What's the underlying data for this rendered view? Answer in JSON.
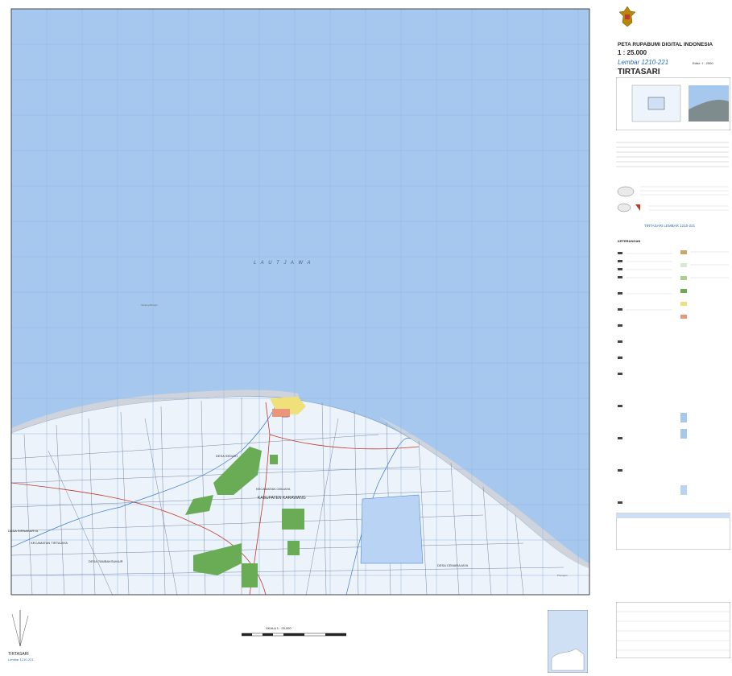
{
  "header": {
    "title": "PETA RUPABUMI DIGITAL INDONESIA",
    "scale": "1 : 25.000",
    "sheet": "Lembar 1210-221",
    "name": "TIRTASARI",
    "edition": "Edisi : I - 2000"
  },
  "map": {
    "sea_label": "L A U T   J A W A",
    "place_labels": [
      "DESA SEDARI",
      "KECAMATAN CIBUAYA",
      "KABUPATEN KARAWANG",
      "DESA SIRNAKARYA",
      "KECAMATAN TIRTAJAYA",
      "DESA TAMBAKSUMUR",
      "DESA CEMARAJAYA",
      "Sedari",
      "Pisangan",
      "Tanjung Bungin"
    ],
    "colors": {
      "sea": "#a6c8ef",
      "land": "#edf3fb",
      "vegetation": "#6aac56",
      "settlement": "#f0e07a",
      "grid": "#8fb4e0"
    }
  },
  "bottom": {
    "sheet_label": "TIRTASARI",
    "sheet_sub": "Lembar 1210-221",
    "scale_label": "SKALA 1 : 25.000"
  },
  "panel": {
    "footer_title": "TIRTASARI LEMBAR 1210-221",
    "legend_title": "KETERANGAN"
  }
}
